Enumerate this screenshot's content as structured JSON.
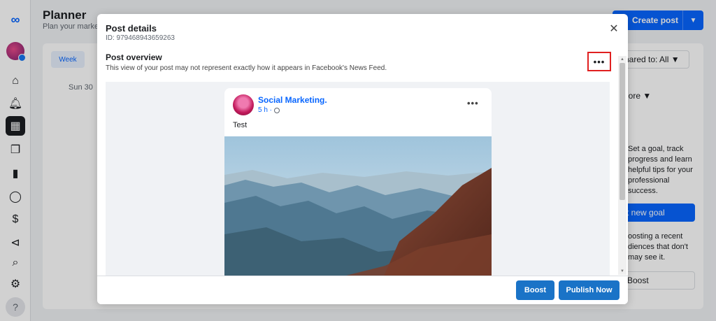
{
  "background": {
    "title": "Planner",
    "subtitle": "Plan your market",
    "create_post": "Create post",
    "week_tab": "Week",
    "day_label": "Sun 30",
    "shared_to": "hared to: All",
    "more": "lore",
    "goal_text": "Set a goal, track progress and learn helpful tips for your professional success.",
    "goal_button": "t new goal",
    "boost_text": "oosting a recent diences that don't may see it.",
    "boost_button": "Boost"
  },
  "modal": {
    "title": "Post details",
    "id": "ID: 979468943659263",
    "overview_title": "Post overview",
    "overview_desc": "This view of your post may not represent exactly how it appears in Facebook's News Feed.",
    "menu_glyph": "•••",
    "close_glyph": "✕"
  },
  "post": {
    "page_name": "Social Marketing.",
    "time": "5 h ·",
    "text": "Test",
    "dots": "•••"
  },
  "footer": {
    "boost": "Boost",
    "publish": "Publish Now"
  },
  "icons": {
    "logo": "meta-logo-icon",
    "home": "home-icon",
    "bell": "notifications-icon",
    "planner": "planner-icon",
    "content": "content-icon",
    "insights": "insights-icon",
    "inbox": "inbox-icon",
    "monetize": "monetization-icon",
    "ads": "ads-icon",
    "search": "search-icon",
    "settings": "gear-icon",
    "help": "help-icon"
  },
  "colors": {
    "accent": "#0866ff",
    "button": "#1a73c7",
    "highlight": "#e02020"
  }
}
